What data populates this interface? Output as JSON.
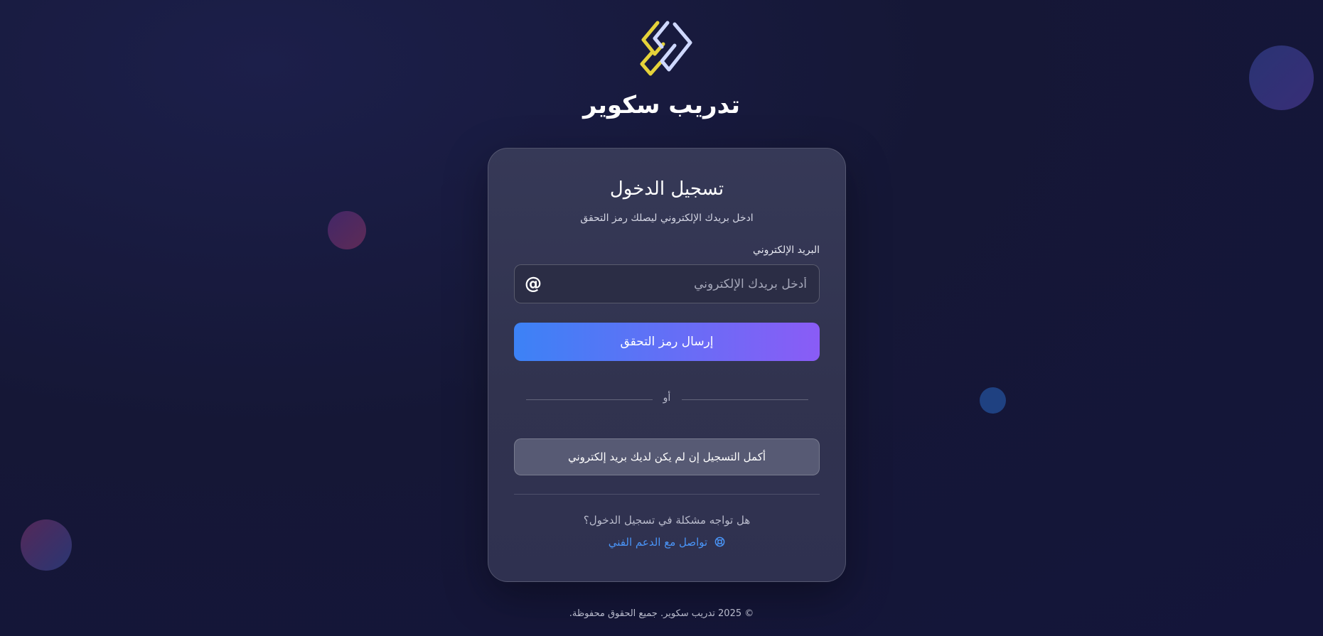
{
  "brand": {
    "name": "تدريب سكوير",
    "logo_icon": "brand-logo"
  },
  "card": {
    "title": "تسجيل الدخول",
    "subtitle": "ادخل بريدك الإلكتروني ليصلك رمز التحقق",
    "email": {
      "label": "البريد الإلكتروني",
      "placeholder": "أدخل بريدك الإلكتروني",
      "value": "",
      "icon": "at-icon"
    },
    "send_button": "إرسال رمز التحقق",
    "divider_text": "أو",
    "complete_registration_button": "أكمل التسجيل إن لم يكن لديك بريد إلكتروني",
    "trouble_text": "هل تواجه مشكلة في تسجيل الدخول؟",
    "support_link": "تواصل مع الدعم الفني",
    "support_icon": "lifebuoy-icon"
  },
  "footer": {
    "copyright": "© 2025 تدريب سكوير. جميع الحقوق محفوظة."
  },
  "colors": {
    "background": "#161838",
    "card": "#33354f",
    "accent_start": "#3c82f6",
    "accent_end": "#8a5cf6",
    "link": "#4a95f7",
    "logo_yellow": "#e5d23a",
    "logo_light": "#cfd8ff"
  }
}
